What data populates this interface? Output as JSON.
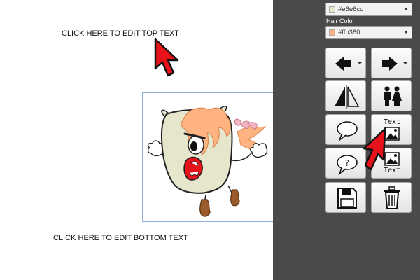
{
  "canvas": {
    "top_text": "CLICK HERE TO EDIT TOP TEXT",
    "bottom_text": "CLICK HERE TO EDIT BOTTOM TEXT"
  },
  "panel": {
    "skin_color": {
      "value": "#e6e6cc",
      "swatch": "#e6e6cc"
    },
    "hair_color_label": "Hair Color",
    "hair_color": {
      "value": "#ffb380",
      "swatch": "#ffb380"
    },
    "tools": {
      "text_above_image": "Text",
      "text_below_image": "Text"
    }
  },
  "colors": {
    "panel_bg": "#4a4a4a",
    "cursor_red": "#e8121a",
    "skin": "#e6e6cc",
    "hair": "#ffb380"
  }
}
